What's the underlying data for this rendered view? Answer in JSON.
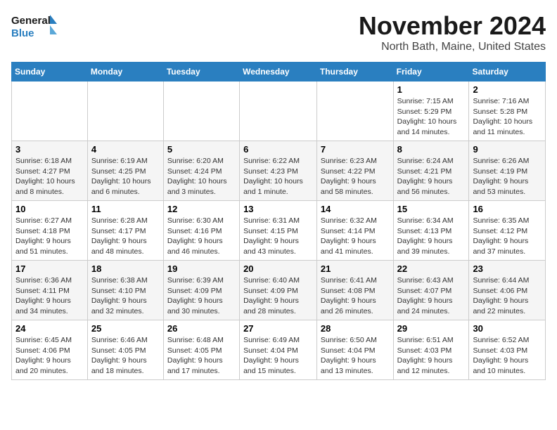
{
  "logo": {
    "line1": "General",
    "line2": "Blue"
  },
  "title": "November 2024",
  "location": "North Bath, Maine, United States",
  "days_header": [
    "Sunday",
    "Monday",
    "Tuesday",
    "Wednesday",
    "Thursday",
    "Friday",
    "Saturday"
  ],
  "weeks": [
    [
      {
        "day": "",
        "info": ""
      },
      {
        "day": "",
        "info": ""
      },
      {
        "day": "",
        "info": ""
      },
      {
        "day": "",
        "info": ""
      },
      {
        "day": "",
        "info": ""
      },
      {
        "day": "1",
        "info": "Sunrise: 7:15 AM\nSunset: 5:29 PM\nDaylight: 10 hours and 14 minutes."
      },
      {
        "day": "2",
        "info": "Sunrise: 7:16 AM\nSunset: 5:28 PM\nDaylight: 10 hours and 11 minutes."
      }
    ],
    [
      {
        "day": "3",
        "info": "Sunrise: 6:18 AM\nSunset: 4:27 PM\nDaylight: 10 hours and 8 minutes."
      },
      {
        "day": "4",
        "info": "Sunrise: 6:19 AM\nSunset: 4:25 PM\nDaylight: 10 hours and 6 minutes."
      },
      {
        "day": "5",
        "info": "Sunrise: 6:20 AM\nSunset: 4:24 PM\nDaylight: 10 hours and 3 minutes."
      },
      {
        "day": "6",
        "info": "Sunrise: 6:22 AM\nSunset: 4:23 PM\nDaylight: 10 hours and 1 minute."
      },
      {
        "day": "7",
        "info": "Sunrise: 6:23 AM\nSunset: 4:22 PM\nDaylight: 9 hours and 58 minutes."
      },
      {
        "day": "8",
        "info": "Sunrise: 6:24 AM\nSunset: 4:21 PM\nDaylight: 9 hours and 56 minutes."
      },
      {
        "day": "9",
        "info": "Sunrise: 6:26 AM\nSunset: 4:19 PM\nDaylight: 9 hours and 53 minutes."
      }
    ],
    [
      {
        "day": "10",
        "info": "Sunrise: 6:27 AM\nSunset: 4:18 PM\nDaylight: 9 hours and 51 minutes."
      },
      {
        "day": "11",
        "info": "Sunrise: 6:28 AM\nSunset: 4:17 PM\nDaylight: 9 hours and 48 minutes."
      },
      {
        "day": "12",
        "info": "Sunrise: 6:30 AM\nSunset: 4:16 PM\nDaylight: 9 hours and 46 minutes."
      },
      {
        "day": "13",
        "info": "Sunrise: 6:31 AM\nSunset: 4:15 PM\nDaylight: 9 hours and 43 minutes."
      },
      {
        "day": "14",
        "info": "Sunrise: 6:32 AM\nSunset: 4:14 PM\nDaylight: 9 hours and 41 minutes."
      },
      {
        "day": "15",
        "info": "Sunrise: 6:34 AM\nSunset: 4:13 PM\nDaylight: 9 hours and 39 minutes."
      },
      {
        "day": "16",
        "info": "Sunrise: 6:35 AM\nSunset: 4:12 PM\nDaylight: 9 hours and 37 minutes."
      }
    ],
    [
      {
        "day": "17",
        "info": "Sunrise: 6:36 AM\nSunset: 4:11 PM\nDaylight: 9 hours and 34 minutes."
      },
      {
        "day": "18",
        "info": "Sunrise: 6:38 AM\nSunset: 4:10 PM\nDaylight: 9 hours and 32 minutes."
      },
      {
        "day": "19",
        "info": "Sunrise: 6:39 AM\nSunset: 4:09 PM\nDaylight: 9 hours and 30 minutes."
      },
      {
        "day": "20",
        "info": "Sunrise: 6:40 AM\nSunset: 4:09 PM\nDaylight: 9 hours and 28 minutes."
      },
      {
        "day": "21",
        "info": "Sunrise: 6:41 AM\nSunset: 4:08 PM\nDaylight: 9 hours and 26 minutes."
      },
      {
        "day": "22",
        "info": "Sunrise: 6:43 AM\nSunset: 4:07 PM\nDaylight: 9 hours and 24 minutes."
      },
      {
        "day": "23",
        "info": "Sunrise: 6:44 AM\nSunset: 4:06 PM\nDaylight: 9 hours and 22 minutes."
      }
    ],
    [
      {
        "day": "24",
        "info": "Sunrise: 6:45 AM\nSunset: 4:06 PM\nDaylight: 9 hours and 20 minutes."
      },
      {
        "day": "25",
        "info": "Sunrise: 6:46 AM\nSunset: 4:05 PM\nDaylight: 9 hours and 18 minutes."
      },
      {
        "day": "26",
        "info": "Sunrise: 6:48 AM\nSunset: 4:05 PM\nDaylight: 9 hours and 17 minutes."
      },
      {
        "day": "27",
        "info": "Sunrise: 6:49 AM\nSunset: 4:04 PM\nDaylight: 9 hours and 15 minutes."
      },
      {
        "day": "28",
        "info": "Sunrise: 6:50 AM\nSunset: 4:04 PM\nDaylight: 9 hours and 13 minutes."
      },
      {
        "day": "29",
        "info": "Sunrise: 6:51 AM\nSunset: 4:03 PM\nDaylight: 9 hours and 12 minutes."
      },
      {
        "day": "30",
        "info": "Sunrise: 6:52 AM\nSunset: 4:03 PM\nDaylight: 9 hours and 10 minutes."
      }
    ]
  ]
}
